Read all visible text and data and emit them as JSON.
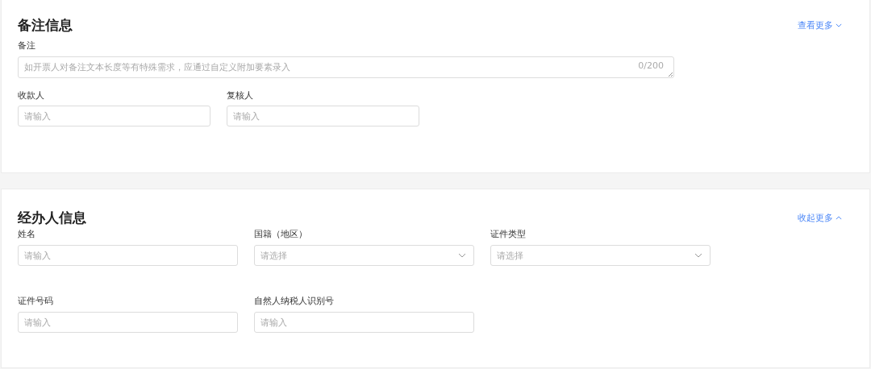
{
  "sections": [
    {
      "title": "备注信息",
      "toggle": {
        "label": "查看更多",
        "expanded": false
      },
      "rows": [
        [
          {
            "label": "备注",
            "kind": "textarea",
            "placeholder": "如开票人对备注文本长度等有特殊需求，应通过自定义附加要素录入",
            "counter": "0/200"
          }
        ],
        [
          {
            "label": "收款人",
            "kind": "input",
            "placeholder": "请输入"
          },
          {
            "label": "复核人",
            "kind": "input",
            "placeholder": "请输入"
          }
        ]
      ]
    },
    {
      "title": "经办人信息",
      "toggle": {
        "label": "收起更多",
        "expanded": true
      },
      "rows": [
        [
          {
            "label": "姓名",
            "kind": "input",
            "placeholder": "请输入"
          },
          {
            "label": "国籍（地区）",
            "kind": "select",
            "placeholder": "请选择"
          },
          {
            "label": "证件类型",
            "kind": "select",
            "placeholder": "请选择"
          }
        ],
        [
          {
            "label": "证件号码",
            "kind": "input",
            "placeholder": "请输入"
          },
          {
            "label": "自然人纳税人识别号",
            "kind": "input",
            "placeholder": "请输入"
          }
        ]
      ]
    }
  ]
}
